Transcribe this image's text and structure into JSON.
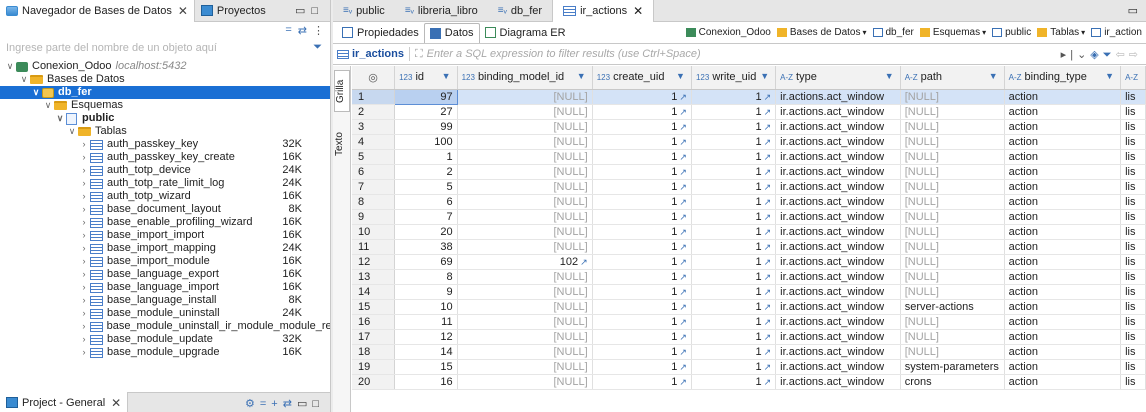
{
  "left_panel": {
    "tabs": [
      {
        "label": "Navegador de Bases de Datos",
        "close": "✕",
        "active": true
      },
      {
        "label": "Proyectos",
        "active": false
      }
    ],
    "filter_placeholder": "Ingrese parte del nombre de un objeto aquí",
    "tree": {
      "connection": {
        "name": "Conexion_Odoo",
        "host": "localhost:5432"
      },
      "databases_folder": "Bases de Datos",
      "database": "db_fer",
      "schemas_folder": "Esquemas",
      "schema": "public",
      "tables_folder": "Tablas",
      "tables": [
        {
          "name": "auth_passkey_key",
          "size": "32K"
        },
        {
          "name": "auth_passkey_key_create",
          "size": "16K"
        },
        {
          "name": "auth_totp_device",
          "size": "24K"
        },
        {
          "name": "auth_totp_rate_limit_log",
          "size": "24K"
        },
        {
          "name": "auth_totp_wizard",
          "size": "16K"
        },
        {
          "name": "base_document_layout",
          "size": "8K"
        },
        {
          "name": "base_enable_profiling_wizard",
          "size": "16K"
        },
        {
          "name": "base_import_import",
          "size": "16K"
        },
        {
          "name": "base_import_mapping",
          "size": "24K"
        },
        {
          "name": "base_import_module",
          "size": "16K"
        },
        {
          "name": "base_language_export",
          "size": "16K"
        },
        {
          "name": "base_language_import",
          "size": "16K"
        },
        {
          "name": "base_language_install",
          "size": "8K"
        },
        {
          "name": "base_module_uninstall",
          "size": "24K"
        },
        {
          "name": "base_module_uninstall_ir_module_module_rel",
          "size": ""
        },
        {
          "name": "base_module_update",
          "size": "32K"
        },
        {
          "name": "base_module_upgrade",
          "size": "16K"
        }
      ]
    },
    "bottom_tab": {
      "label": "Project - General",
      "close": "✕"
    }
  },
  "editor": {
    "tabs": [
      {
        "label": "public",
        "active": false
      },
      {
        "label": "libreria_libro",
        "active": false
      },
      {
        "label": "db_fer",
        "active": false
      },
      {
        "label": "ir_actions",
        "close": "✕",
        "active": true
      }
    ],
    "subtabs": [
      {
        "label": "Propiedades",
        "active": false
      },
      {
        "label": "Datos",
        "active": true
      },
      {
        "label": "Diagrama ER",
        "active": false
      }
    ],
    "crumbs": [
      {
        "label": "Conexion_Odoo",
        "dropdown": false
      },
      {
        "label": "Bases de Datos",
        "dropdown": true
      },
      {
        "label": "db_fer",
        "dropdown": false
      },
      {
        "label": "Esquemas",
        "dropdown": true
      },
      {
        "label": "public",
        "dropdown": false
      },
      {
        "label": "Tablas",
        "dropdown": true
      },
      {
        "label": "ir_action",
        "dropdown": false
      }
    ],
    "object_label": "ir_actions",
    "sql_filter_placeholder": "Enter a SQL expression to filter results (use Ctrl+Space)",
    "vertical_tabs": [
      {
        "label": "Grilla",
        "active": true
      },
      {
        "label": "Texto",
        "active": false
      }
    ]
  },
  "grid": {
    "columns": [
      {
        "label": "id",
        "type": "123"
      },
      {
        "label": "binding_model_id",
        "type": "123"
      },
      {
        "label": "create_uid",
        "type": "123"
      },
      {
        "label": "write_uid",
        "type": "123"
      },
      {
        "label": "type",
        "type": "A-Z"
      },
      {
        "label": "path",
        "type": "A-Z"
      },
      {
        "label": "binding_type",
        "type": "A-Z"
      },
      {
        "label": "",
        "type": "A-Z"
      }
    ],
    "null_text": "[NULL]",
    "rows": [
      {
        "n": "1",
        "id": "97",
        "bm": "[NULL]",
        "cu": "1",
        "wu": "1",
        "type": "ir.actions.act_window",
        "path": "[NULL]",
        "bt": "action",
        "x": "lis"
      },
      {
        "n": "2",
        "id": "27",
        "bm": "[NULL]",
        "cu": "1",
        "wu": "1",
        "type": "ir.actions.act_window",
        "path": "[NULL]",
        "bt": "action",
        "x": "lis"
      },
      {
        "n": "3",
        "id": "99",
        "bm": "[NULL]",
        "cu": "1",
        "wu": "1",
        "type": "ir.actions.act_window",
        "path": "[NULL]",
        "bt": "action",
        "x": "lis"
      },
      {
        "n": "4",
        "id": "100",
        "bm": "[NULL]",
        "cu": "1",
        "wu": "1",
        "type": "ir.actions.act_window",
        "path": "[NULL]",
        "bt": "action",
        "x": "lis"
      },
      {
        "n": "5",
        "id": "1",
        "bm": "[NULL]",
        "cu": "1",
        "wu": "1",
        "type": "ir.actions.act_window",
        "path": "[NULL]",
        "bt": "action",
        "x": "lis"
      },
      {
        "n": "6",
        "id": "2",
        "bm": "[NULL]",
        "cu": "1",
        "wu": "1",
        "type": "ir.actions.act_window",
        "path": "[NULL]",
        "bt": "action",
        "x": "lis"
      },
      {
        "n": "7",
        "id": "5",
        "bm": "[NULL]",
        "cu": "1",
        "wu": "1",
        "type": "ir.actions.act_window",
        "path": "[NULL]",
        "bt": "action",
        "x": "lis"
      },
      {
        "n": "8",
        "id": "6",
        "bm": "[NULL]",
        "cu": "1",
        "wu": "1",
        "type": "ir.actions.act_window",
        "path": "[NULL]",
        "bt": "action",
        "x": "lis"
      },
      {
        "n": "9",
        "id": "7",
        "bm": "[NULL]",
        "cu": "1",
        "wu": "1",
        "type": "ir.actions.act_window",
        "path": "[NULL]",
        "bt": "action",
        "x": "lis"
      },
      {
        "n": "10",
        "id": "20",
        "bm": "[NULL]",
        "cu": "1",
        "wu": "1",
        "type": "ir.actions.act_window",
        "path": "[NULL]",
        "bt": "action",
        "x": "lis"
      },
      {
        "n": "11",
        "id": "38",
        "bm": "[NULL]",
        "cu": "1",
        "wu": "1",
        "type": "ir.actions.act_window",
        "path": "[NULL]",
        "bt": "action",
        "x": "lis"
      },
      {
        "n": "12",
        "id": "69",
        "bm": "102",
        "cu": "1",
        "wu": "1",
        "type": "ir.actions.act_window",
        "path": "[NULL]",
        "bt": "action",
        "x": "lis"
      },
      {
        "n": "13",
        "id": "8",
        "bm": "[NULL]",
        "cu": "1",
        "wu": "1",
        "type": "ir.actions.act_window",
        "path": "[NULL]",
        "bt": "action",
        "x": "lis"
      },
      {
        "n": "14",
        "id": "9",
        "bm": "[NULL]",
        "cu": "1",
        "wu": "1",
        "type": "ir.actions.act_window",
        "path": "[NULL]",
        "bt": "action",
        "x": "lis"
      },
      {
        "n": "15",
        "id": "10",
        "bm": "[NULL]",
        "cu": "1",
        "wu": "1",
        "type": "ir.actions.act_window",
        "path": "server-actions",
        "bt": "action",
        "x": "lis"
      },
      {
        "n": "16",
        "id": "11",
        "bm": "[NULL]",
        "cu": "1",
        "wu": "1",
        "type": "ir.actions.act_window",
        "path": "[NULL]",
        "bt": "action",
        "x": "lis"
      },
      {
        "n": "17",
        "id": "12",
        "bm": "[NULL]",
        "cu": "1",
        "wu": "1",
        "type": "ir.actions.act_window",
        "path": "[NULL]",
        "bt": "action",
        "x": "lis"
      },
      {
        "n": "18",
        "id": "14",
        "bm": "[NULL]",
        "cu": "1",
        "wu": "1",
        "type": "ir.actions.act_window",
        "path": "[NULL]",
        "bt": "action",
        "x": "lis"
      },
      {
        "n": "19",
        "id": "15",
        "bm": "[NULL]",
        "cu": "1",
        "wu": "1",
        "type": "ir.actions.act_window",
        "path": "system-parameters",
        "bt": "action",
        "x": "lis"
      },
      {
        "n": "20",
        "id": "16",
        "bm": "[NULL]",
        "cu": "1",
        "wu": "1",
        "type": "ir.actions.act_window",
        "path": "crons",
        "bt": "action",
        "x": "lis"
      }
    ]
  },
  "colors": {
    "selection": "#1a6fd4",
    "accent": "#3a70b4",
    "null": "#a3a3a3"
  }
}
